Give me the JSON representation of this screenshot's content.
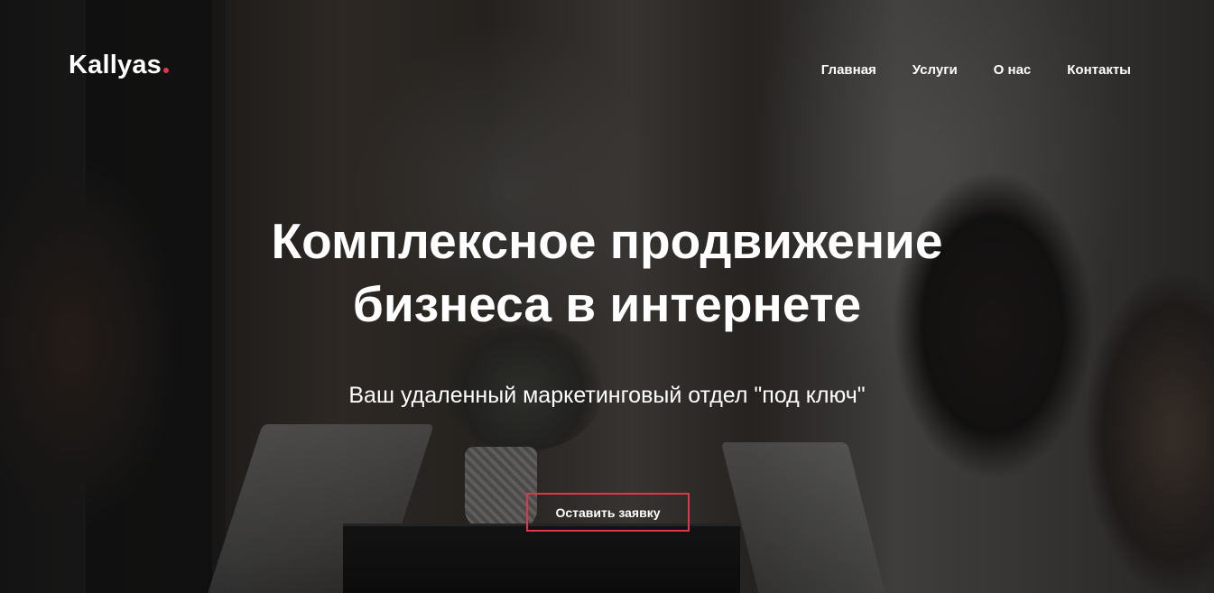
{
  "brand": {
    "name": "Kallyas",
    "accent_color": "#e0354a"
  },
  "nav": {
    "items": [
      {
        "label": "Главная"
      },
      {
        "label": "Услуги"
      },
      {
        "label": "О нас"
      },
      {
        "label": "Контакты"
      }
    ]
  },
  "hero": {
    "title_line1": "Комплексное продвижение",
    "title_line2": "бизнеса в интернете",
    "subtitle": "Ваш удаленный маркетинговый отдел \"под ключ\"",
    "cta_label": "Оставить заявку"
  }
}
